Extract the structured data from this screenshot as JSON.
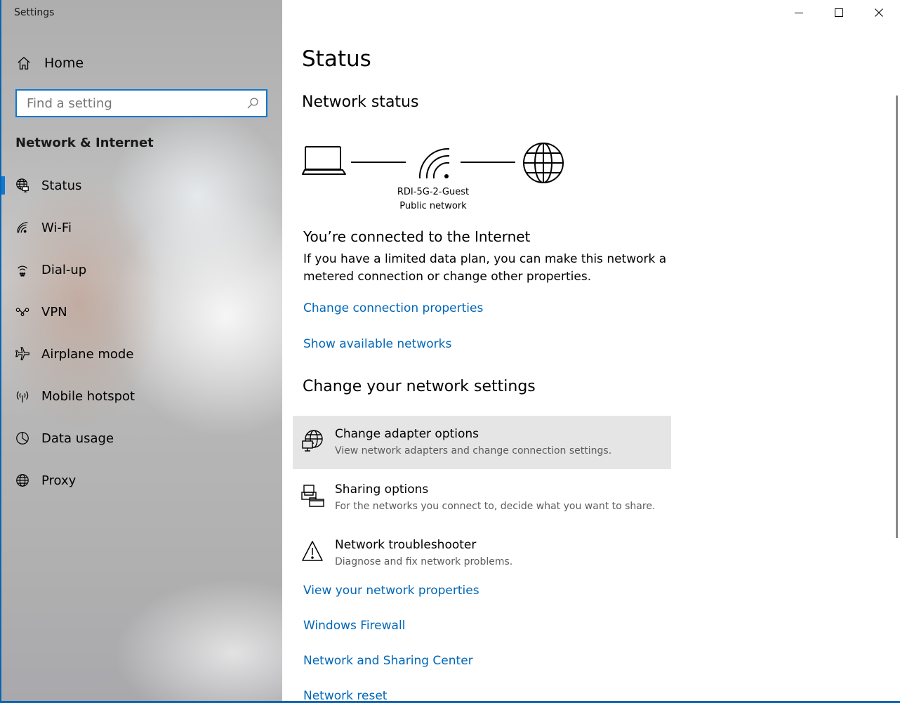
{
  "window": {
    "title": "Settings"
  },
  "titlebar": {
    "minimize": "minimize",
    "maximize": "maximize",
    "close": "close"
  },
  "sidebar": {
    "home_label": "Home",
    "search_placeholder": "Find a setting",
    "section_title": "Network & Internet",
    "items": [
      {
        "label": "Status",
        "icon": "globe-status-icon",
        "selected": true
      },
      {
        "label": "Wi-Fi",
        "icon": "wifi-icon"
      },
      {
        "label": "Dial-up",
        "icon": "dialup-icon"
      },
      {
        "label": "VPN",
        "icon": "vpn-icon"
      },
      {
        "label": "Airplane mode",
        "icon": "airplane-icon"
      },
      {
        "label": "Mobile hotspot",
        "icon": "hotspot-icon"
      },
      {
        "label": "Data usage",
        "icon": "data-usage-icon"
      },
      {
        "label": "Proxy",
        "icon": "globe-icon"
      }
    ]
  },
  "main": {
    "title": "Status",
    "network_status_heading": "Network status",
    "network_name": "RDI-5G-2-Guest",
    "network_type": "Public network",
    "connected_heading": "You’re connected to the Internet",
    "connected_desc": "If you have a limited data plan, you can make this network a metered connection or change other properties.",
    "links_top": [
      "Change connection properties",
      "Show available networks"
    ],
    "change_heading": "Change your network settings",
    "options": [
      {
        "title": "Change adapter options",
        "subtitle": "View network adapters and change connection settings.",
        "icon": "adapter-icon"
      },
      {
        "title": "Sharing options",
        "subtitle": "For the networks you connect to, decide what you want to share.",
        "icon": "sharing-icon"
      },
      {
        "title": "Network troubleshooter",
        "subtitle": "Diagnose and fix network problems.",
        "icon": "warning-icon"
      }
    ],
    "links_bottom": [
      "View your network properties",
      "Windows Firewall",
      "Network and Sharing Center",
      "Network reset"
    ]
  },
  "colors": {
    "accent": "#0f78d4",
    "link": "#0067b8",
    "hover": "#e5e5e5"
  }
}
